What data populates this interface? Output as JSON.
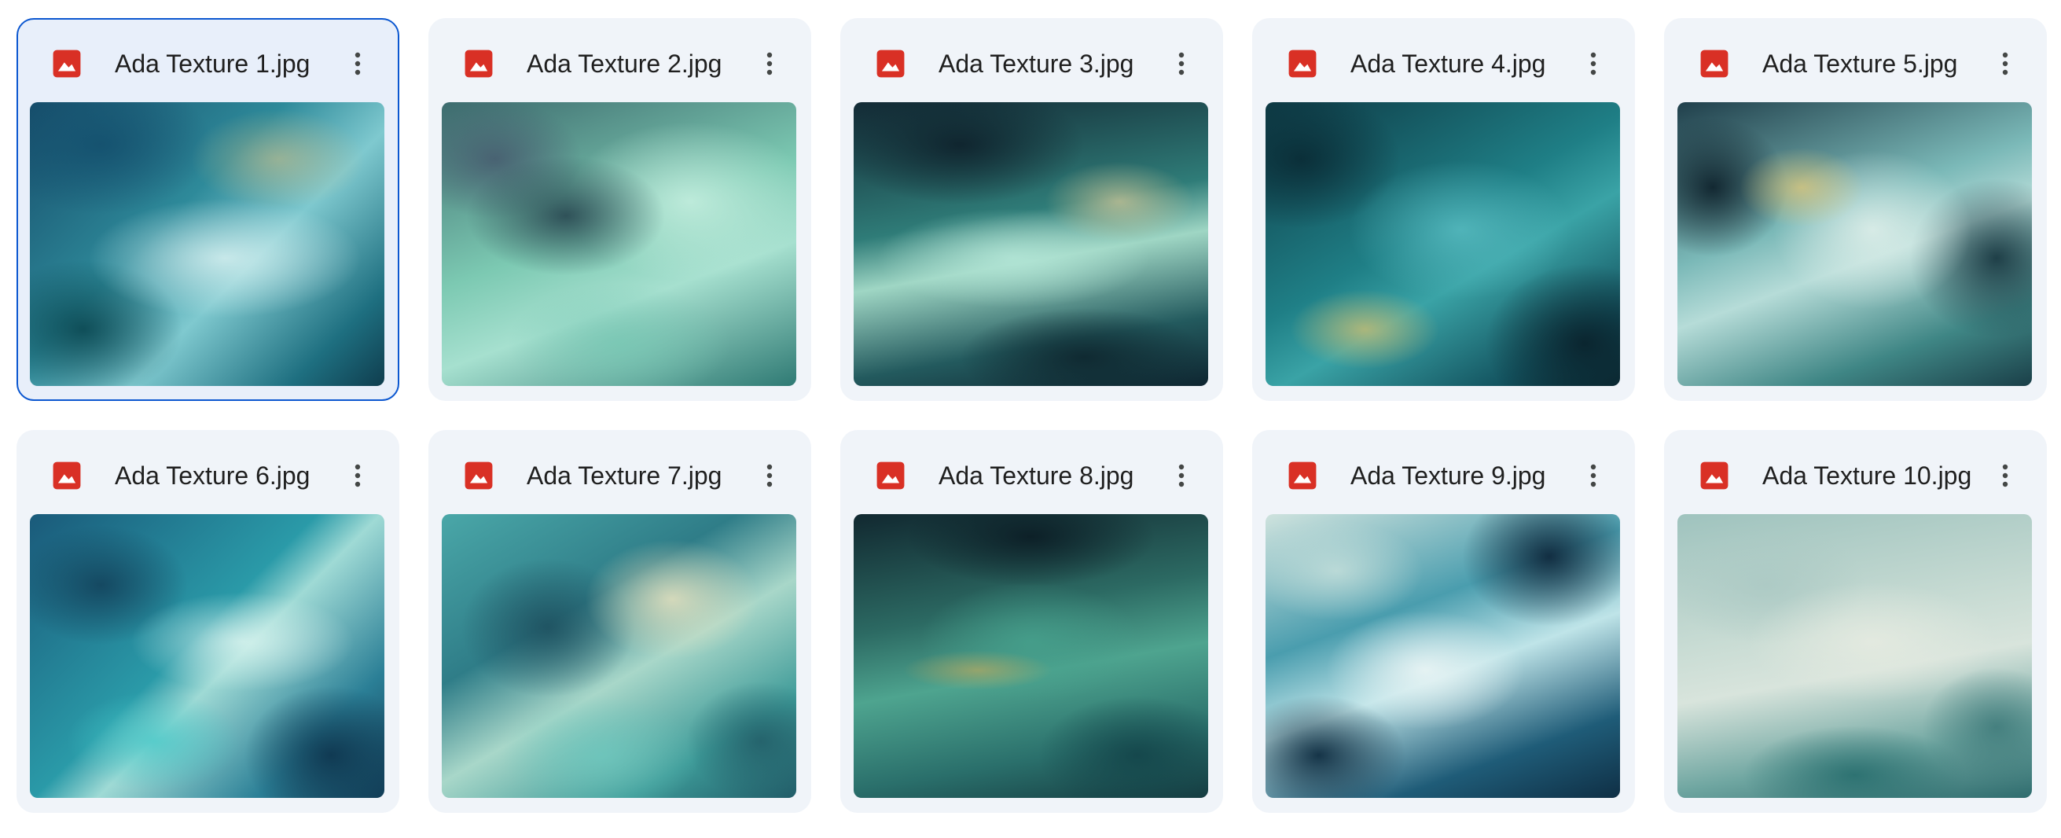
{
  "files": [
    {
      "name": "Ada Texture 1.jpg",
      "icon": "image-file-icon",
      "selected": true
    },
    {
      "name": "Ada Texture 2.jpg",
      "icon": "image-file-icon",
      "selected": false
    },
    {
      "name": "Ada Texture 3.jpg",
      "icon": "image-file-icon",
      "selected": false
    },
    {
      "name": "Ada Texture 4.jpg",
      "icon": "image-file-icon",
      "selected": false
    },
    {
      "name": "Ada Texture 5.jpg",
      "icon": "image-file-icon",
      "selected": false
    },
    {
      "name": "Ada Texture 6.jpg",
      "icon": "image-file-icon",
      "selected": false
    },
    {
      "name": "Ada Texture 7.jpg",
      "icon": "image-file-icon",
      "selected": false
    },
    {
      "name": "Ada Texture 8.jpg",
      "icon": "image-file-icon",
      "selected": false
    },
    {
      "name": "Ada Texture 9.jpg",
      "icon": "image-file-icon",
      "selected": false
    },
    {
      "name": "Ada Texture 10.jpg",
      "icon": "image-file-icon",
      "selected": false
    }
  ],
  "colors": {
    "card_background": "#f0f4f9",
    "selected_border": "#0b57d0",
    "image_icon": "#d93025",
    "text": "#1f1f1f",
    "more_icon": "#444746"
  }
}
